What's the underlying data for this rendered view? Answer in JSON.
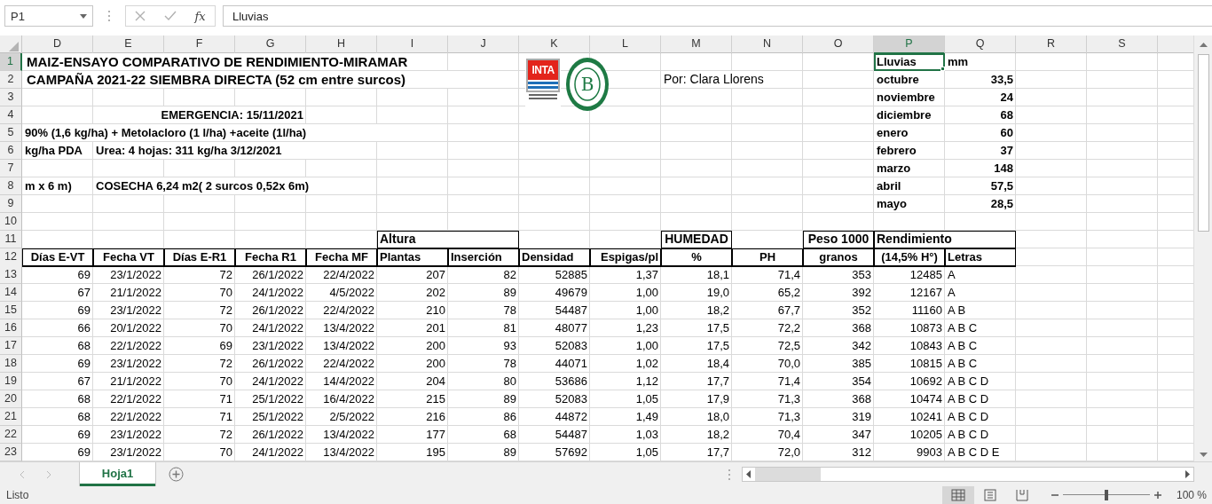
{
  "formula_bar": {
    "name_box": "P1",
    "function_label": "fx",
    "formula": "Lluvias"
  },
  "column_letters": [
    {
      "label": "D",
      "selected": false
    },
    {
      "label": "E",
      "selected": false
    },
    {
      "label": "F",
      "selected": false
    },
    {
      "label": "G",
      "selected": false
    },
    {
      "label": "H",
      "selected": false
    },
    {
      "label": "I",
      "selected": false
    },
    {
      "label": "J",
      "selected": false
    },
    {
      "label": "K",
      "selected": false
    },
    {
      "label": "L",
      "selected": false
    },
    {
      "label": "M",
      "selected": false
    },
    {
      "label": "N",
      "selected": false
    },
    {
      "label": "O",
      "selected": false
    },
    {
      "label": "P",
      "selected": true
    },
    {
      "label": "Q",
      "selected": false
    },
    {
      "label": "R",
      "selected": false
    },
    {
      "label": "S",
      "selected": false
    }
  ],
  "row_numbers": [
    {
      "label": "1",
      "selected": true
    },
    {
      "label": "2",
      "selected": false
    },
    {
      "label": "3",
      "selected": false
    },
    {
      "label": "4",
      "selected": false
    },
    {
      "label": "5",
      "selected": false
    },
    {
      "label": "6",
      "selected": false
    },
    {
      "label": "7",
      "selected": false
    },
    {
      "label": "8",
      "selected": false
    },
    {
      "label": "9",
      "selected": false
    },
    {
      "label": "10",
      "selected": false
    },
    {
      "label": "11",
      "selected": false
    },
    {
      "label": "12",
      "selected": false
    },
    {
      "label": "13",
      "selected": false
    },
    {
      "label": "14",
      "selected": false
    },
    {
      "label": "15",
      "selected": false
    },
    {
      "label": "16",
      "selected": false
    },
    {
      "label": "17",
      "selected": false
    },
    {
      "label": "18",
      "selected": false
    },
    {
      "label": "19",
      "selected": false
    },
    {
      "label": "20",
      "selected": false
    },
    {
      "label": "21",
      "selected": false
    },
    {
      "label": "22",
      "selected": false
    },
    {
      "label": "23",
      "selected": false
    }
  ],
  "title_lines": [
    "MAIZ-ENSAYO COMPARATIVO DE RENDIMIENTO-MIRAMAR",
    "CAMPAÑA 2021-22 SIEMBRA DIRECTA (52 cm entre surcos)"
  ],
  "author": "Por: Clara Llorens",
  "logos": [
    {
      "kind": "inta",
      "text": "INTA"
    },
    {
      "kind": "seal",
      "text": "B"
    }
  ],
  "notes": [
    [
      "EMERGENCIA: 15/11/2021"
    ],
    [
      "90% (1,6 kg/ha) + Metolacloro (1 l/ha) +aceite (1l/ha)"
    ],
    [
      "kg/ha PDA",
      "Urea: 4 hojas: 311 kg/ha 3/12/2021"
    ],
    [
      "m x 6 m)",
      "COSECHA 6,24 m2( 2 surcos 0,52x 6m)"
    ]
  ],
  "rainfall": {
    "label": "Lluvias",
    "unit": "mm",
    "selected": true,
    "months": [
      {
        "month": "octubre",
        "mm": "33,5"
      },
      {
        "month": "noviembre",
        "mm": "24"
      },
      {
        "month": "diciembre",
        "mm": "68"
      },
      {
        "month": "enero",
        "mm": "60"
      },
      {
        "month": "febrero",
        "mm": "37"
      },
      {
        "month": "marzo",
        "mm": "148"
      },
      {
        "month": "abril",
        "mm": "57,5"
      },
      {
        "month": "mayo",
        "mm": "28,5"
      }
    ]
  },
  "table": {
    "columns": [
      {
        "label": "Días E-VT"
      },
      {
        "label": "Fecha VT"
      },
      {
        "label": "Días E-R1"
      },
      {
        "label": "Fecha R1"
      },
      {
        "label": "Fecha MF"
      },
      {
        "label": "Plantas",
        "group": {
          "text": "Altura",
          "merged": true
        }
      },
      {
        "label": "Inserción"
      },
      {
        "label": "Densidad"
      },
      {
        "label": "Espigas/pl"
      },
      {
        "label": "%",
        "group": {
          "text": "HUMEDAD",
          "merged": false
        }
      },
      {
        "label": "PH"
      },
      {
        "label": "granos",
        "group": {
          "text": "Peso 1000",
          "merged": false
        }
      },
      {
        "label": "(14,5% H°)",
        "group": {
          "text": "Rendimiento",
          "merged": true
        }
      },
      {
        "label": "Letras"
      }
    ],
    "rows": [
      [
        "69",
        "23/1/2022",
        "72",
        "26/1/2022",
        "22/4/2022",
        "207",
        "82",
        "52885",
        "1,37",
        "18,1",
        "71,4",
        "353",
        "12485",
        "A"
      ],
      [
        "67",
        "21/1/2022",
        "70",
        "24/1/2022",
        "4/5/2022",
        "202",
        "89",
        "49679",
        "1,00",
        "19,0",
        "65,2",
        "392",
        "12167",
        "A"
      ],
      [
        "69",
        "23/1/2022",
        "72",
        "26/1/2022",
        "22/4/2022",
        "210",
        "78",
        "54487",
        "1,00",
        "18,2",
        "67,7",
        "352",
        "11160",
        "A B"
      ],
      [
        "66",
        "20/1/2022",
        "70",
        "24/1/2022",
        "13/4/2022",
        "201",
        "81",
        "48077",
        "1,23",
        "17,5",
        "72,2",
        "368",
        "10873",
        "A B C"
      ],
      [
        "68",
        "22/1/2022",
        "69",
        "23/1/2022",
        "13/4/2022",
        "200",
        "93",
        "52083",
        "1,00",
        "17,5",
        "72,5",
        "342",
        "10843",
        "A B C"
      ],
      [
        "69",
        "23/1/2022",
        "72",
        "26/1/2022",
        "22/4/2022",
        "200",
        "78",
        "44071",
        "1,02",
        "18,4",
        "70,0",
        "385",
        "10815",
        "A B C"
      ],
      [
        "67",
        "21/1/2022",
        "70",
        "24/1/2022",
        "14/4/2022",
        "204",
        "80",
        "53686",
        "1,12",
        "17,7",
        "71,4",
        "354",
        "10692",
        "A B C D"
      ],
      [
        "68",
        "22/1/2022",
        "71",
        "25/1/2022",
        "16/4/2022",
        "215",
        "89",
        "52083",
        "1,05",
        "17,9",
        "71,3",
        "368",
        "10474",
        "A B C D"
      ],
      [
        "68",
        "22/1/2022",
        "71",
        "25/1/2022",
        "2/5/2022",
        "216",
        "86",
        "44872",
        "1,49",
        "18,0",
        "71,3",
        "319",
        "10241",
        "A B C D"
      ],
      [
        "69",
        "23/1/2022",
        "72",
        "26/1/2022",
        "13/4/2022",
        "177",
        "68",
        "54487",
        "1,03",
        "18,2",
        "70,4",
        "347",
        "10205",
        "A B C D"
      ],
      [
        "69",
        "23/1/2022",
        "70",
        "24/1/2022",
        "13/4/2022",
        "195",
        "89",
        "57692",
        "1,05",
        "17,7",
        "72,0",
        "312",
        "9903",
        "A B C D E"
      ]
    ]
  },
  "sheet_tabs": [
    {
      "label": "Hoja1",
      "selected": true
    }
  ],
  "status_bar": {
    "status": "Listo",
    "views": [
      {
        "kind": "normal",
        "selected": true
      },
      {
        "kind": "page-layout",
        "selected": false
      },
      {
        "kind": "page-break",
        "selected": false
      }
    ],
    "zoom_slider": {
      "level": 0.5
    },
    "zoom": "100 %"
  }
}
